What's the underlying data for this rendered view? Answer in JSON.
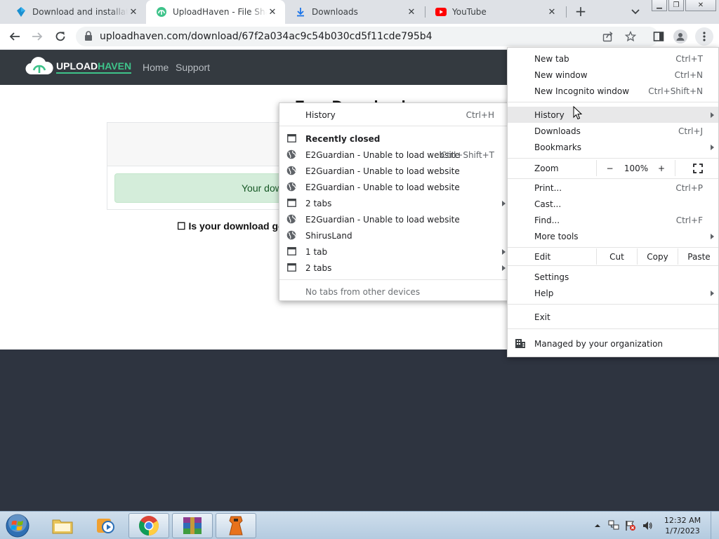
{
  "tabs": [
    {
      "title": "Download and installatio",
      "icon": "blue-diamond-icon"
    },
    {
      "title": "UploadHaven - File Sharin",
      "icon": "uploadhaven-favicon"
    },
    {
      "title": "Downloads",
      "icon": "download-arrow-icon"
    },
    {
      "title": "YouTube",
      "icon": "youtube-icon"
    }
  ],
  "address": {
    "url": "uploadhaven.com/download/67f2a034ac9c54b030cd5f11cde795b4"
  },
  "site": {
    "logo_upload": "UPLOAD",
    "logo_haven": "HAVEN",
    "nav_home": "Home",
    "nav_support": "Support",
    "title": "Free Download",
    "alert": "Your dow",
    "question": "☐ Is your download goin"
  },
  "main_menu": {
    "new_tab": {
      "label": "New tab",
      "shortcut": "Ctrl+T"
    },
    "new_window": {
      "label": "New window",
      "shortcut": "Ctrl+N"
    },
    "new_incognito": {
      "label": "New Incognito window",
      "shortcut": "Ctrl+Shift+N"
    },
    "history": {
      "label": "History"
    },
    "downloads": {
      "label": "Downloads",
      "shortcut": "Ctrl+J"
    },
    "bookmarks": {
      "label": "Bookmarks"
    },
    "zoom": {
      "label": "Zoom",
      "minus": "−",
      "level": "100%",
      "plus": "+"
    },
    "print": {
      "label": "Print...",
      "shortcut": "Ctrl+P"
    },
    "cast": {
      "label": "Cast..."
    },
    "find": {
      "label": "Find...",
      "shortcut": "Ctrl+F"
    },
    "more_tools": {
      "label": "More tools"
    },
    "edit": {
      "label": "Edit",
      "cut": "Cut",
      "copy": "Copy",
      "paste": "Paste"
    },
    "settings": {
      "label": "Settings"
    },
    "help": {
      "label": "Help"
    },
    "exit": {
      "label": "Exit"
    },
    "managed": {
      "label": "Managed by your organization"
    }
  },
  "history_menu": {
    "history": {
      "label": "History",
      "shortcut": "Ctrl+H"
    },
    "recently_closed": "Recently closed",
    "items": [
      {
        "label": "E2Guardian - Unable to load website",
        "shortcut": "Ctrl+Shift+T",
        "icon": "globe-icon"
      },
      {
        "label": "E2Guardian - Unable to load website",
        "shortcut": "",
        "icon": "globe-icon"
      },
      {
        "label": "E2Guardian - Unable to load website",
        "shortcut": "",
        "icon": "globe-icon"
      },
      {
        "label": "2 tabs",
        "shortcut": "",
        "icon": "window-icon"
      },
      {
        "label": "E2Guardian - Unable to load website",
        "shortcut": "",
        "icon": "globe-icon"
      },
      {
        "label": "ShirusLand",
        "shortcut": "",
        "icon": "globe-icon"
      },
      {
        "label": "1 tab",
        "shortcut": "",
        "icon": "window-icon"
      },
      {
        "label": "2 tabs",
        "shortcut": "",
        "icon": "window-icon"
      }
    ],
    "no_tabs": "No tabs from other devices"
  },
  "taskbar": {
    "time": "12:32 AM",
    "date": "1/7/2023"
  },
  "colors": {
    "tabstrip": "#dee1e6",
    "site_nav": "#343a40",
    "brand_green": "#3ec38a",
    "alert_bg": "#d4edda",
    "page_dark": "#2e3440"
  }
}
